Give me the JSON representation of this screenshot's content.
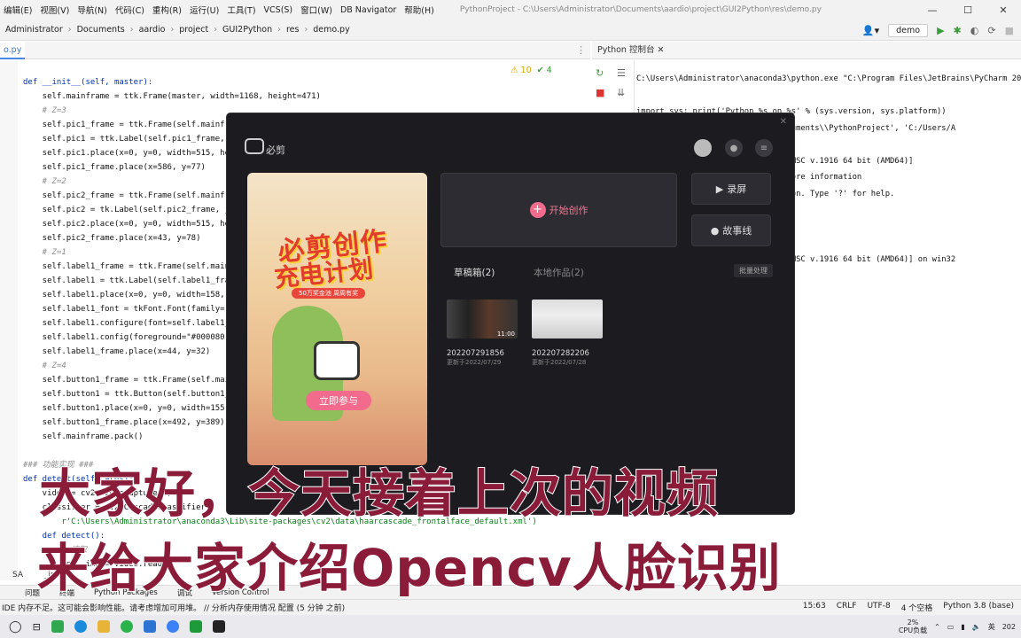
{
  "menu": [
    "编辑(E)",
    "视图(V)",
    "导航(N)",
    "代码(C)",
    "重构(R)",
    "运行(U)",
    "工具(T)",
    "VCS(S)",
    "窗口(W)",
    "DB Navigator",
    "帮助(H)"
  ],
  "window_title": "PythonProject - C:\\Users\\Administrator\\Documents\\aardio\\project\\GUI2Python\\res\\demo.py",
  "breadcrumbs": [
    "Administrator",
    "Documents",
    "aardio",
    "project",
    "GUI2Python",
    "res",
    "demo.py"
  ],
  "run_config": "demo",
  "editor_tab": "o.py",
  "inspections": {
    "warnings": "⚠ 10",
    "ok": "✔ 4"
  },
  "code_lines": [
    {
      "t": "def __init__(self, master):",
      "c": "kw"
    },
    {
      "t": "    self.mainframe = ttk.Frame(master, width=1168, height=471)",
      "c": ""
    },
    {
      "t": "    # Z=3",
      "c": "cm"
    },
    {
      "t": "    self.pic1_frame = ttk.Frame(self.mainfr",
      "c": ""
    },
    {
      "t": "    self.pic1 = ttk.Label(self.pic1_frame, j",
      "c": ""
    },
    {
      "t": "    self.pic1.place(x=0, y=0, width=515, he",
      "c": ""
    },
    {
      "t": "    self.pic1_frame.place(x=586, y=77)",
      "c": ""
    },
    {
      "t": "    # Z=2",
      "c": "cm"
    },
    {
      "t": "    self.pic2_frame = ttk.Frame(self.mainfr",
      "c": ""
    },
    {
      "t": "    self.pic2 = tk.Label(self.pic2_frame, j",
      "c": ""
    },
    {
      "t": "    self.pic2.place(x=0, y=0, width=515, he",
      "c": ""
    },
    {
      "t": "    self.pic2_frame.place(x=43, y=78)",
      "c": ""
    },
    {
      "t": "    # Z=1",
      "c": "cm"
    },
    {
      "t": "    self.label1_frame = ttk.Frame(self.main",
      "c": ""
    },
    {
      "t": "    self.label1 = ttk.Label(self.label1_fra",
      "c": ""
    },
    {
      "t": "    self.label1.place(x=0, y=0, width=158,",
      "c": ""
    },
    {
      "t": "    self.label1_font = tkFont.Font(family=\"",
      "c": ""
    },
    {
      "t": "    self.label1.configure(font=self.label1_",
      "c": ""
    },
    {
      "t": "    self.label1.config(foreground=\"#000080\"",
      "c": ""
    },
    {
      "t": "    self.label1_frame.place(x=44, y=32)",
      "c": ""
    },
    {
      "t": "    # Z=4",
      "c": "cm"
    },
    {
      "t": "    self.button1_frame = ttk.Frame(self.mai",
      "c": ""
    },
    {
      "t": "    self.button1 = ttk.Button(self.button1_",
      "c": ""
    },
    {
      "t": "    self.button1.place(x=0, y=0, width=155,",
      "c": ""
    },
    {
      "t": "    self.button1_frame.place(x=492, y=389)",
      "c": ""
    },
    {
      "t": "    self.mainframe.pack()",
      "c": ""
    },
    {
      "t": "",
      "c": ""
    },
    {
      "t": "### 功能实现 ###",
      "c": "cm"
    },
    {
      "t": "def detect(self, args):",
      "c": "kw"
    },
    {
      "t": "    video = cv2.VideoCapture(0)",
      "c": ""
    },
    {
      "t": "    classifier = cv2.CascadeClassifier(",
      "c": ""
    },
    {
      "t": "        r'C:\\Users\\Administrator\\anaconda3\\Lib\\site-packages\\cv2\\data\\haarcascade_frontalface_default.xml')",
      "c": "st"
    },
    {
      "t": "    def detect():",
      "c": "kw"
    },
    {
      "t": "        # 读取",
      "c": "cm"
    },
    {
      "t": "        ret, img = video.read()",
      "c": ""
    }
  ],
  "console_tab": "Python 控制台",
  "console_lines": [
    "C:\\Users\\Administrator\\anaconda3\\python.exe \"C:\\Program Files\\JetBrains\\PyCharm 20",
    "",
    "import sys; print('Python %s on %s' % (sys.version, sys.platform))",
    "                   nistrator\\\\Documents\\\\PythonProject', 'C:/Users/A",
    "",
    "                    , 15:08:03) [MSC v.1916 64 bit (AMD64)]",
    "                    icense' for more information",
    "                    eractive Python. Type '?' for help.",
    "                    0",
    "",
    "",
    "                    , 15:08:03) [MSC v.1916 64 bit (AMD64)] on win32"
  ],
  "bottom_tabs": [
    "问题",
    "终端",
    "Python Packages",
    "调试",
    "Version Control"
  ],
  "structure_label": "SA",
  "structure_crumb": "_in",
  "status": {
    "message": "IDE 内存不足。这可能会影响性能。请考虑增加可用堆。 // 分析内存使用情况  配置 (5 分钟 之前)",
    "position": "15:63",
    "line_sep": "CRLF",
    "encoding": "UTF-8",
    "indent": "4 个空格",
    "interpreter": "Python 3.8 (base)"
  },
  "tray": {
    "cpu": "2%",
    "cpu_label": "CPU负载",
    "ime": "英",
    "year": "202"
  },
  "app": {
    "name": "必剪",
    "banner_title1": "必剪创作",
    "banner_title2": "充电计划",
    "banner_sub": "50万奖金池  周周有奖",
    "banner_button": "立即参与",
    "create_label": "开始创作",
    "record_label": "录屏",
    "story_label": "故事线",
    "tab_draft": "草稿箱(2)",
    "tab_local": "本地作品(2)",
    "batch_label": "批量处理",
    "drafts": [
      {
        "name": "202207291856",
        "date": "更新于2022/07/29",
        "duration": "11:00"
      },
      {
        "name": "202207282206",
        "date": "更新于2022/07/28",
        "duration": ""
      }
    ]
  },
  "subtitle1": "大家好，今天接着上次的视频",
  "subtitle2": "来给大家介绍Opencv人脸识别"
}
